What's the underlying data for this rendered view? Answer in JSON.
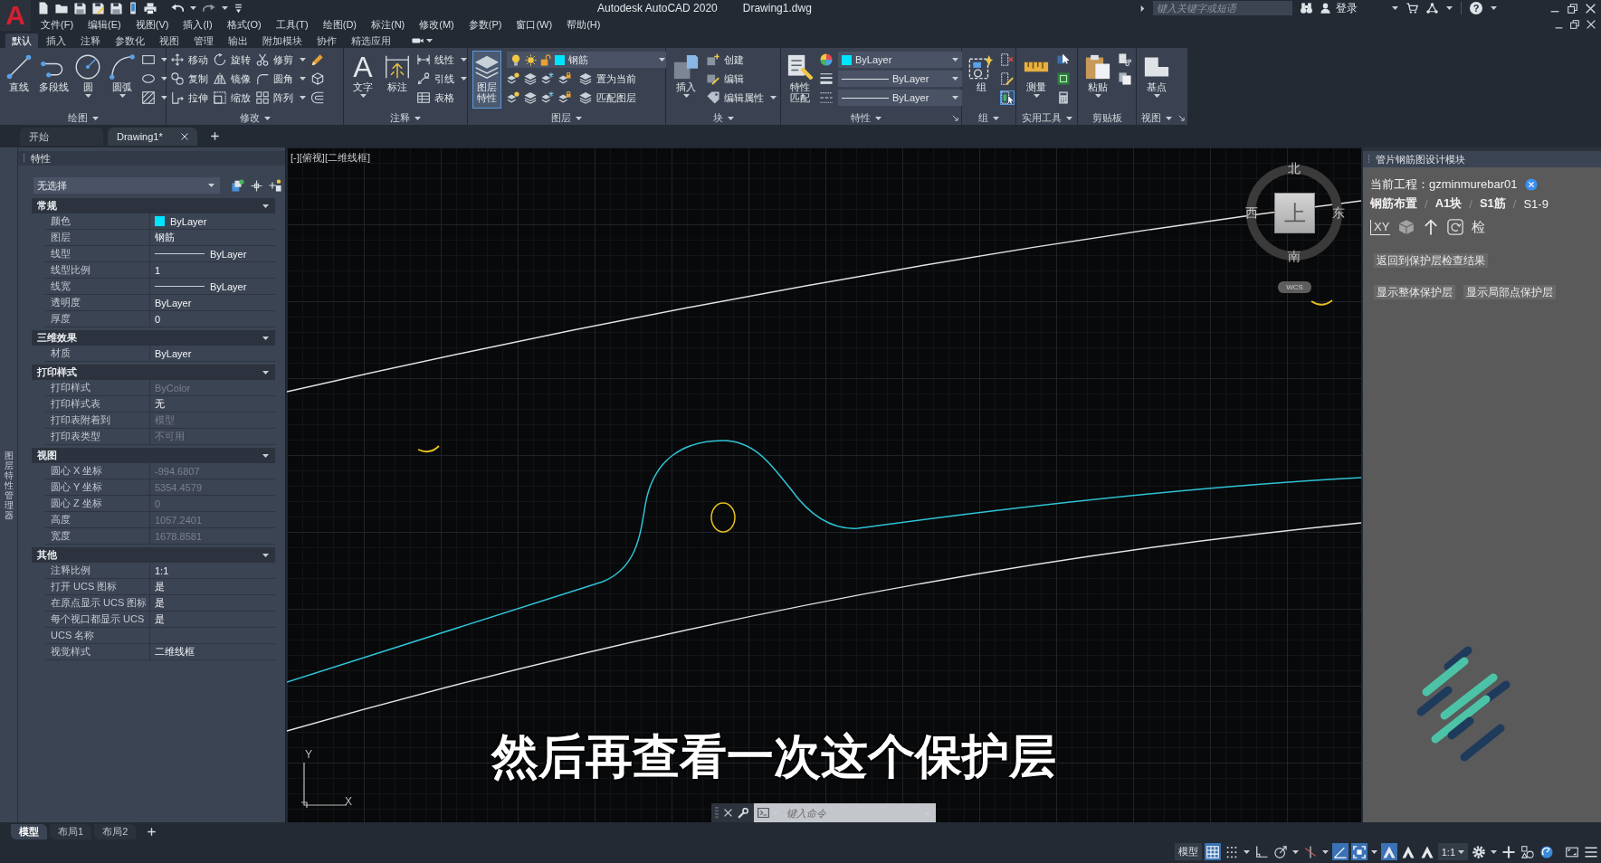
{
  "title_bar": {
    "app_button": "A",
    "app_title": "Autodesk AutoCAD 2020",
    "file_name": "Drawing1.dwg",
    "search": {
      "placeholder": "键入关键字或短语"
    },
    "sign_in": "登录",
    "help": "?"
  },
  "menu_bar": [
    "文件(F)",
    "编辑(E)",
    "视图(V)",
    "插入(I)",
    "格式(O)",
    "工具(T)",
    "绘图(D)",
    "标注(N)",
    "修改(M)",
    "参数(P)",
    "窗口(W)",
    "帮助(H)"
  ],
  "ribbon_tabs": [
    {
      "label": "默认",
      "selected": true
    },
    {
      "label": "插入",
      "selected": false
    },
    {
      "label": "注释",
      "selected": false
    },
    {
      "label": "参数化",
      "selected": false
    },
    {
      "label": "视图",
      "selected": false
    },
    {
      "label": "管理",
      "selected": false
    },
    {
      "label": "输出",
      "selected": false
    },
    {
      "label": "附加模块",
      "selected": false
    },
    {
      "label": "协作",
      "selected": false
    },
    {
      "label": "精选应用",
      "selected": false
    }
  ],
  "ribbon_panels": [
    {
      "title": "绘图",
      "menu": true,
      "launcher": false,
      "columns": [
        {
          "kind": "large",
          "label": "直线",
          "dropdown": false,
          "highlighted": false
        },
        {
          "kind": "large",
          "label": "多段线",
          "dropdown": false,
          "highlighted": false
        },
        {
          "kind": "large",
          "label": "圆",
          "dropdown": true,
          "highlighted": false
        },
        {
          "kind": "large",
          "label": "圆弧",
          "dropdown": true,
          "highlighted": false
        },
        {
          "kind": "stack",
          "items": [
            {
              "dropdown": true
            },
            {
              "dropdown": true
            },
            {
              "dropdown": true
            }
          ]
        }
      ]
    },
    {
      "title": "修改",
      "menu": true,
      "launcher": false,
      "columns": [
        {
          "kind": "stack",
          "items": [
            {
              "label": "移动",
              "dropdown": false
            },
            {
              "label": "复制",
              "dropdown": false
            },
            {
              "label": "拉伸",
              "dropdown": false
            }
          ]
        },
        {
          "kind": "stack",
          "items": [
            {
              "label": "旋转",
              "dropdown": false
            },
            {
              "label": "镜像",
              "dropdown": false
            },
            {
              "label": "缩放",
              "dropdown": false
            }
          ]
        },
        {
          "kind": "stack",
          "items": [
            {
              "label": "修剪",
              "dropdown": true
            },
            {
              "label": "圆角",
              "dropdown": true
            },
            {
              "label": "阵列",
              "dropdown": true
            }
          ]
        },
        {
          "kind": "stack",
          "items": [
            {
              "dropdown": false
            },
            {
              "dropdown": false
            },
            {
              "dropdown": false
            }
          ]
        }
      ]
    },
    {
      "title": "注释",
      "menu": true,
      "launcher": false,
      "columns": [
        {
          "kind": "large",
          "glyph": "A",
          "label": "文字",
          "dropdown": true,
          "highlighted": false
        },
        {
          "kind": "large",
          "label": "标注",
          "dropdown": false,
          "highlighted": false
        },
        {
          "kind": "stack",
          "items": [
            {
              "label": "线性",
              "dropdown": true
            },
            {
              "label": "引线",
              "dropdown": true
            },
            {
              "label": "表格",
              "dropdown": false
            }
          ]
        }
      ]
    },
    {
      "title": "图层",
      "menu": true,
      "launcher": false,
      "columns": [
        {
          "kind": "large",
          "label": "图层特性",
          "dropdown": false,
          "highlighted": true
        },
        {
          "kind": "layers",
          "layer": {
            "name": "钢筋",
            "color": "#00e5ff"
          },
          "rows": [
            {
              "label": "置为当前"
            },
            {
              "label": "匹配图层"
            }
          ]
        }
      ]
    },
    {
      "title": "块",
      "menu": true,
      "launcher": false,
      "columns": [
        {
          "kind": "large",
          "label": "插入",
          "dropdown": true,
          "highlighted": false
        },
        {
          "kind": "stack",
          "items": [
            {
              "label": "创建",
              "dropdown": false
            },
            {
              "label": "编辑",
              "dropdown": false
            },
            {
              "label": "编辑属性",
              "dropdown": true
            }
          ]
        }
      ]
    },
    {
      "title": "特性",
      "menu": true,
      "launcher": true,
      "columns": [
        {
          "kind": "large",
          "label": "特性匹配",
          "dropdown": false,
          "highlighted": false
        },
        {
          "kind": "combos",
          "rows": [
            {
              "kind": "swatch",
              "value": "ByLayer",
              "color": "#00e5ff"
            },
            {
              "kind": "line",
              "value": "ByLayer"
            },
            {
              "kind": "line",
              "value": "ByLayer"
            }
          ]
        }
      ]
    },
    {
      "title": "组",
      "menu": true,
      "launcher": false,
      "columns": [
        {
          "kind": "large",
          "label": "组",
          "dropdown": false,
          "highlighted": false
        },
        {
          "kind": "stack",
          "items": [
            {
              "dropdown": false,
              "highlighted": false
            },
            {
              "dropdown": false,
              "highlighted": false
            },
            {
              "dropdown": false,
              "highlighted": true
            }
          ]
        }
      ]
    },
    {
      "title": "实用工具",
      "menu": true,
      "launcher": false,
      "columns": [
        {
          "kind": "large",
          "label": "测量",
          "dropdown": true,
          "highlighted": false
        },
        {
          "kind": "stack",
          "items": [
            {
              "dropdown": false
            },
            {
              "dropdown": false
            },
            {
              "dropdown": false
            }
          ]
        }
      ]
    },
    {
      "title": "剪贴板",
      "menu": false,
      "launcher": false,
      "columns": [
        {
          "kind": "large",
          "label": "粘贴",
          "dropdown": true,
          "highlighted": false
        },
        {
          "kind": "stack",
          "items": [
            {
              "dropdown": false
            },
            {
              "dropdown": false
            }
          ]
        }
      ]
    },
    {
      "title": "视图",
      "menu": true,
      "launcher": true,
      "columns": [
        {
          "kind": "large",
          "label": "基点",
          "dropdown": true,
          "highlighted": false
        }
      ]
    }
  ],
  "document_tabs": [
    {
      "label": "开始",
      "selected": false,
      "closable": false
    },
    {
      "label": "Drawing1*",
      "selected": true,
      "closable": true
    }
  ],
  "properties_palette": {
    "side_tab": "图层特性管理器",
    "title": "特性",
    "selection": "无选择",
    "sections": [
      {
        "title": "常规",
        "expanded": true,
        "rows": [
          {
            "name": "颜色",
            "kind": "swatch",
            "value": "ByLayer",
            "color": "#00e5ff",
            "disabled": false
          },
          {
            "name": "图层",
            "kind": "text",
            "value": "钢筋",
            "disabled": false
          },
          {
            "name": "线型",
            "kind": "line",
            "value": "ByLayer",
            "disabled": false
          },
          {
            "name": "线型比例",
            "kind": "text",
            "value": "1",
            "disabled": false
          },
          {
            "name": "线宽",
            "kind": "line",
            "value": "ByLayer",
            "disabled": false
          },
          {
            "name": "透明度",
            "kind": "text",
            "value": "ByLayer",
            "disabled": false
          },
          {
            "name": "厚度",
            "kind": "text",
            "value": "0",
            "disabled": false
          }
        ]
      },
      {
        "title": "三维效果",
        "expanded": true,
        "rows": [
          {
            "name": "材质",
            "kind": "text",
            "value": "ByLayer",
            "disabled": false
          }
        ]
      },
      {
        "title": "打印样式",
        "expanded": true,
        "rows": [
          {
            "name": "打印样式",
            "kind": "text",
            "value": "ByColor",
            "disabled": true
          },
          {
            "name": "打印样式表",
            "kind": "text",
            "value": "无",
            "disabled": false
          },
          {
            "name": "打印表附着到",
            "kind": "text",
            "value": "模型",
            "disabled": true
          },
          {
            "name": "打印表类型",
            "kind": "text",
            "value": "不可用",
            "disabled": true
          }
        ]
      },
      {
        "title": "视图",
        "expanded": true,
        "rows": [
          {
            "name": "圆心 X 坐标",
            "kind": "text",
            "value": "-994.6807",
            "disabled": true
          },
          {
            "name": "圆心 Y 坐标",
            "kind": "text",
            "value": "5354.4579",
            "disabled": true
          },
          {
            "name": "圆心 Z 坐标",
            "kind": "text",
            "value": "0",
            "disabled": true
          },
          {
            "name": "高度",
            "kind": "text",
            "value": "1057.2401",
            "disabled": true
          },
          {
            "name": "宽度",
            "kind": "text",
            "value": "1678.8581",
            "disabled": true
          }
        ]
      },
      {
        "title": "其他",
        "expanded": true,
        "rows": [
          {
            "name": "注释比例",
            "kind": "text",
            "value": "1:1",
            "disabled": false
          },
          {
            "name": "打开 UCS 图标",
            "kind": "text",
            "value": "是",
            "disabled": false
          },
          {
            "name": "在原点显示 UCS 图标",
            "kind": "text",
            "value": "是",
            "disabled": false
          },
          {
            "name": "每个视口都显示 UCS",
            "kind": "text",
            "value": "是",
            "disabled": false
          },
          {
            "name": "UCS 名称",
            "kind": "text"
          },
          {
            "name": "视觉样式",
            "kind": "text",
            "value": "二维线框",
            "disabled": false
          }
        ]
      }
    ]
  },
  "drawing_area": {
    "viewport_label": "[-][俯视][二维线框]",
    "viewcube": {
      "north": "北",
      "south": "南",
      "west": "西",
      "east": "东",
      "top": "上",
      "coordinate_system": "WCS"
    },
    "ucs_icon": {
      "x_label": "X",
      "y_label": "Y"
    },
    "subtitle": "然后再查看一次这个保护层",
    "command_line": {
      "placeholder": "键入命令"
    }
  },
  "design_panel": {
    "title": "管片钢筋图设计模块",
    "project": "当前工程：gzminmurebar01",
    "breadcrumb": {
      "items": [
        {
          "label": "钢筋布置",
          "current": false
        },
        {
          "label": "A1块",
          "current": false
        },
        {
          "label": "S1筋",
          "current": false
        },
        {
          "label": "S1-9",
          "current": true
        }
      ],
      "separators": [
        "/",
        "/",
        "/"
      ]
    },
    "tools": [
      {
        "kind": "axes",
        "label": "XY"
      },
      {
        "kind": "cube"
      },
      {
        "kind": "arrow"
      },
      {
        "kind": "rotate"
      },
      {
        "kind": "text",
        "label": "检"
      }
    ],
    "button_rows": [
      [
        "返回到保护层检查结果"
      ],
      [
        "显示整体保护层",
        "显示局部点保护层"
      ]
    ]
  },
  "layout_tabs": [
    {
      "label": "模型",
      "selected": true
    },
    {
      "label": "布局1",
      "selected": false
    },
    {
      "label": "布局2",
      "selected": false
    }
  ],
  "status_bar": {
    "items": [
      {
        "kind": "model",
        "label": "模型",
        "on": false
      },
      {
        "kind": "grid",
        "on": true
      },
      {
        "kind": "snap",
        "on": false
      },
      {
        "kind": "ortho",
        "on": false
      },
      {
        "kind": "polar",
        "on": false
      },
      {
        "kind": "isodraft",
        "on": false
      },
      {
        "kind": "tracking",
        "on": true
      },
      {
        "kind": "osnap",
        "on": true
      },
      {
        "kind": "annotation",
        "on": true
      },
      {
        "kind": "autoscale",
        "on": false
      },
      {
        "kind": "scale_icon",
        "on": false
      },
      {
        "kind": "scale",
        "label": "1:1",
        "on": false
      },
      {
        "kind": "gear",
        "on": false
      },
      {
        "kind": "plus",
        "on": false
      },
      {
        "kind": "isolate",
        "on": false
      },
      {
        "kind": "hardware",
        "on": false
      },
      {
        "kind": "fullscreen",
        "on": false
      },
      {
        "kind": "menu",
        "on": false
      }
    ]
  }
}
